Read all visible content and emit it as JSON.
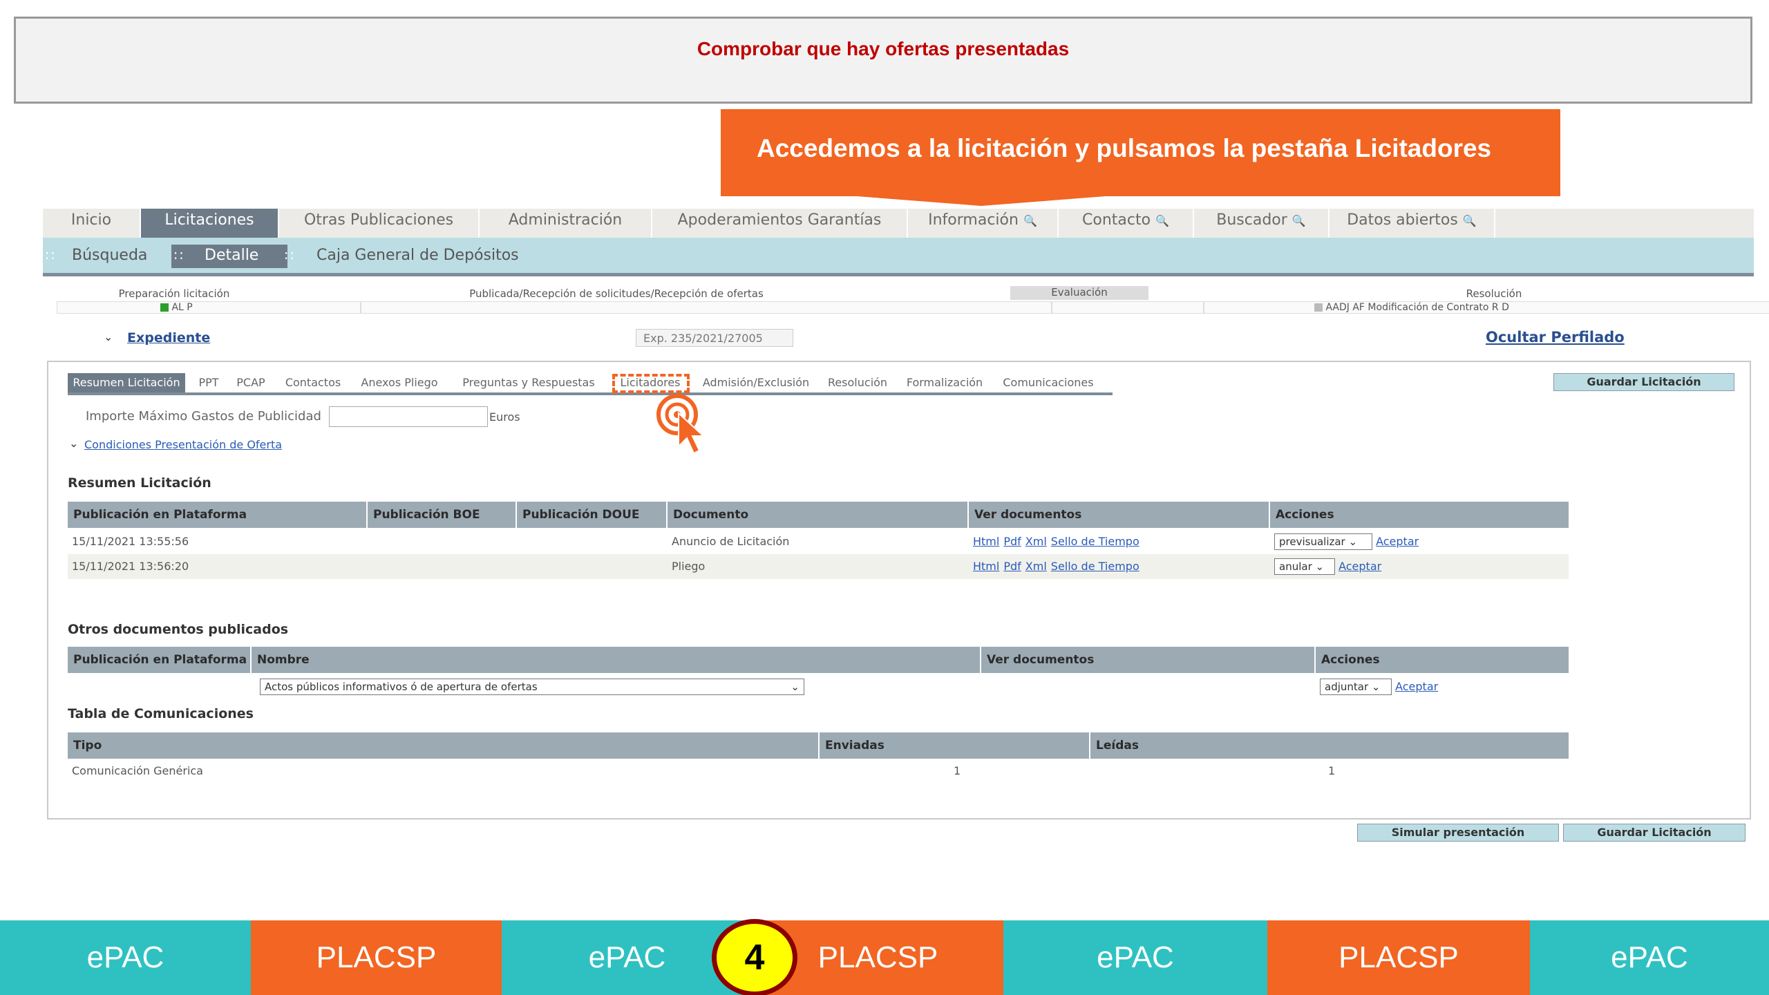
{
  "header": {
    "title": "Comprobar que hay ofertas presentadas",
    "callout": "Accedemos a la licitación y pulsamos la pestaña Licitadores"
  },
  "nav": {
    "items": [
      "Inicio",
      "Licitaciones",
      "Otras Publicaciones",
      "Administración",
      "Apoderamientos Garantías",
      "Información",
      "Contacto",
      "Buscador",
      "Datos abiertos"
    ],
    "active": "Licitaciones"
  },
  "subnav": {
    "items": [
      "Búsqueda",
      "Detalle",
      "Caja General de Depósitos"
    ],
    "active": "Detalle"
  },
  "phases": {
    "preparacion": "Preparación licitación",
    "preparacion_codes": "AL  P",
    "publicada": "Publicada/Recepción de solicitudes/Recepción de ofertas",
    "evaluacion": "Evaluación",
    "resolucion": "Resolución",
    "resolucion_codes": "AADJ  AF  Modificación de Contrato  R  D",
    "color_active": "#2e9e2e",
    "color_inactive": "#bbbbbb"
  },
  "expediente": {
    "link": "Expediente",
    "number": "Exp. 235/2021/27005",
    "ocultar": "Ocultar Perfilado"
  },
  "tabs": {
    "items": [
      "Resumen Licitación",
      "PPT",
      "PCAP",
      "Contactos",
      "Anexos Pliego",
      "Preguntas y Respuestas",
      "Licitadores",
      "Admisión/Exclusión",
      "Resolución",
      "Formalización",
      "Comunicaciones"
    ],
    "active": "Resumen Licitación",
    "highlighted": "Licitadores"
  },
  "form": {
    "importe_label": "Importe Máximo Gastos de Publicidad",
    "importe_value": "",
    "euros": "Euros",
    "condiciones_link": "Condiciones Presentación de Oferta"
  },
  "buttons": {
    "guardar": "Guardar Licitación",
    "simular": "Simular presentación"
  },
  "resumen": {
    "title": "Resumen Licitación",
    "headers": [
      "Publicación en Plataforma",
      "Publicación BOE",
      "Publicación DOUE",
      "Documento",
      "Ver documentos",
      "Acciones"
    ],
    "rows": [
      {
        "fecha": "15/11/2021 13:55:56",
        "boe": "",
        "doue": "",
        "documento": "Anuncio de Licitación",
        "accion": "previsualizar"
      },
      {
        "fecha": "15/11/2021 13:56:20",
        "boe": "",
        "doue": "",
        "documento": "Pliego",
        "accion": "anular"
      }
    ],
    "links": [
      "Html",
      "Pdf",
      "Xml",
      "Sello de Tiempo"
    ],
    "aceptar": "Aceptar"
  },
  "otros": {
    "title": "Otros documentos publicados",
    "headers": [
      "Publicación en Plataforma",
      "Nombre",
      "Ver documentos",
      "Acciones"
    ],
    "nombre_select": "Actos públicos informativos ó de apertura de ofertas",
    "accion": "adjuntar",
    "aceptar": "Aceptar"
  },
  "comunicaciones": {
    "title": "Tabla de Comunicaciones",
    "headers": [
      "Tipo",
      "Enviadas",
      "Leídas"
    ],
    "rows": [
      {
        "tipo": "Comunicación Genérica",
        "enviadas": "1",
        "leidas": "1"
      }
    ]
  },
  "footer": {
    "items": [
      "ePAC",
      "PLACSP",
      "ePAC",
      "PLACSP",
      "ePAC",
      "PLACSP",
      "ePAC"
    ],
    "step": "4",
    "teal": "#2fc1c1",
    "orange": "#f26522"
  }
}
